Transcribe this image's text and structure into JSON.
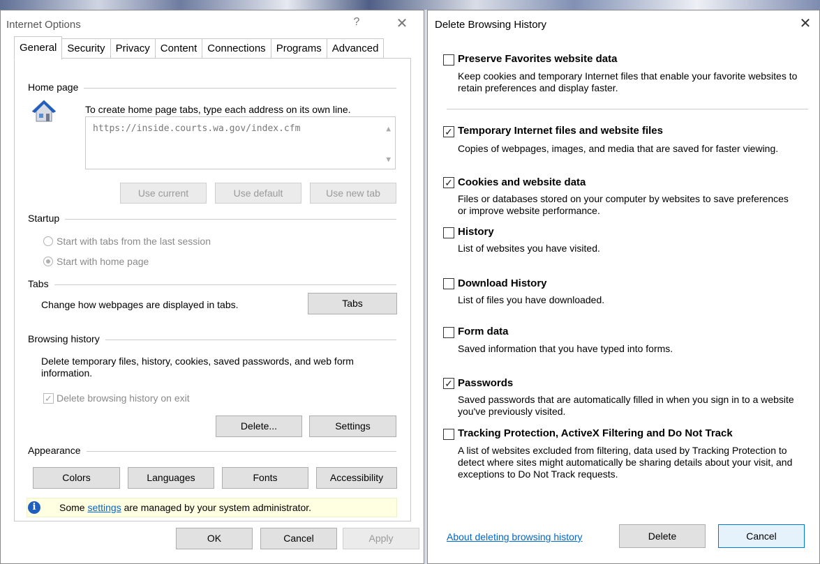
{
  "internet_options": {
    "title": "Internet Options",
    "help_glyph": "?",
    "close_glyph": "✕",
    "tabs": [
      "General",
      "Security",
      "Privacy",
      "Content",
      "Connections",
      "Programs",
      "Advanced"
    ],
    "home_page": {
      "label": "Home page",
      "instruction": "To create home page tabs, type each address on its own line.",
      "address": "https://inside.courts.wa.gov/index.cfm",
      "use_current": "Use current",
      "use_default": "Use default",
      "use_new_tab": "Use new tab"
    },
    "startup": {
      "label": "Startup",
      "option_last_session": "Start with tabs from the last session",
      "option_home_page": "Start with home page",
      "selected": "Start with home page"
    },
    "tabs_group": {
      "label": "Tabs",
      "description": "Change how webpages are displayed in tabs.",
      "button": "Tabs"
    },
    "browsing_history": {
      "label": "Browsing history",
      "description": "Delete temporary files, history, cookies, saved passwords, and web form information.",
      "delete_on_exit": "Delete browsing history on exit",
      "delete_on_exit_checked": true,
      "delete_button": "Delete...",
      "settings_button": "Settings"
    },
    "appearance": {
      "label": "Appearance",
      "colors": "Colors",
      "languages": "Languages",
      "fonts": "Fonts",
      "accessibility": "Accessibility"
    },
    "info": {
      "prefix": "Some ",
      "link": "settings",
      "suffix": " are managed by your system administrator."
    },
    "ok": "OK",
    "cancel": "Cancel",
    "apply": "Apply"
  },
  "delete_browsing_history": {
    "title": "Delete Browsing History",
    "close_glyph": "✕",
    "items": [
      {
        "title": "Preserve Favorites website data",
        "desc": "Keep cookies and temporary Internet files that enable your favorite websites to retain preferences and display faster.",
        "checked": false
      },
      {
        "title": "Temporary Internet files and website files",
        "desc": "Copies of webpages, images, and media that are saved for faster viewing.",
        "checked": true
      },
      {
        "title": "Cookies and website data",
        "desc": "Files or databases stored on your computer by websites to save preferences or improve website performance.",
        "checked": true
      },
      {
        "title": "History",
        "desc": "List of websites you have visited.",
        "checked": false
      },
      {
        "title": "Download History",
        "desc": "List of files you have downloaded.",
        "checked": false
      },
      {
        "title": "Form data",
        "desc": "Saved information that you have typed into forms.",
        "checked": false
      },
      {
        "title": "Passwords",
        "desc": "Saved passwords that are automatically filled in when you sign in to a website you've previously visited.",
        "checked": true
      },
      {
        "title": "Tracking Protection, ActiveX Filtering and Do Not Track",
        "desc": "A list of websites excluded from filtering, data used by Tracking Protection to detect where sites might automatically be sharing details about your visit, and exceptions to Do Not Track requests.",
        "checked": false
      }
    ],
    "about_link": "About deleting browsing history",
    "delete_button": "Delete",
    "cancel_button": "Cancel",
    "check_glyph": "✓"
  },
  "colors": {
    "accent": "#0078d7",
    "link": "#0066cc",
    "info_bg": "#ffffe1"
  }
}
